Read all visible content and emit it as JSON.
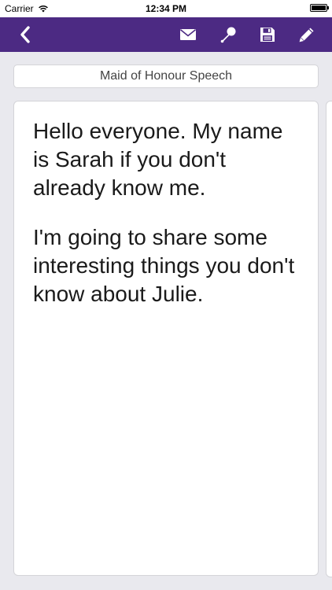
{
  "status_bar": {
    "carrier": "Carrier",
    "time": "12:34 PM"
  },
  "nav_bar": {
    "color": "#4c2a83",
    "back_icon": "chevron-left-icon",
    "actions": [
      "envelope-icon",
      "microphone-icon",
      "save-icon",
      "pencil-icon"
    ]
  },
  "speech": {
    "title": "Maid of Honour Speech",
    "paragraphs": [
      "Hello everyone. My name is Sarah if you don't already know me.",
      "I'm going to share some interesting things you don't know about Julie."
    ]
  }
}
